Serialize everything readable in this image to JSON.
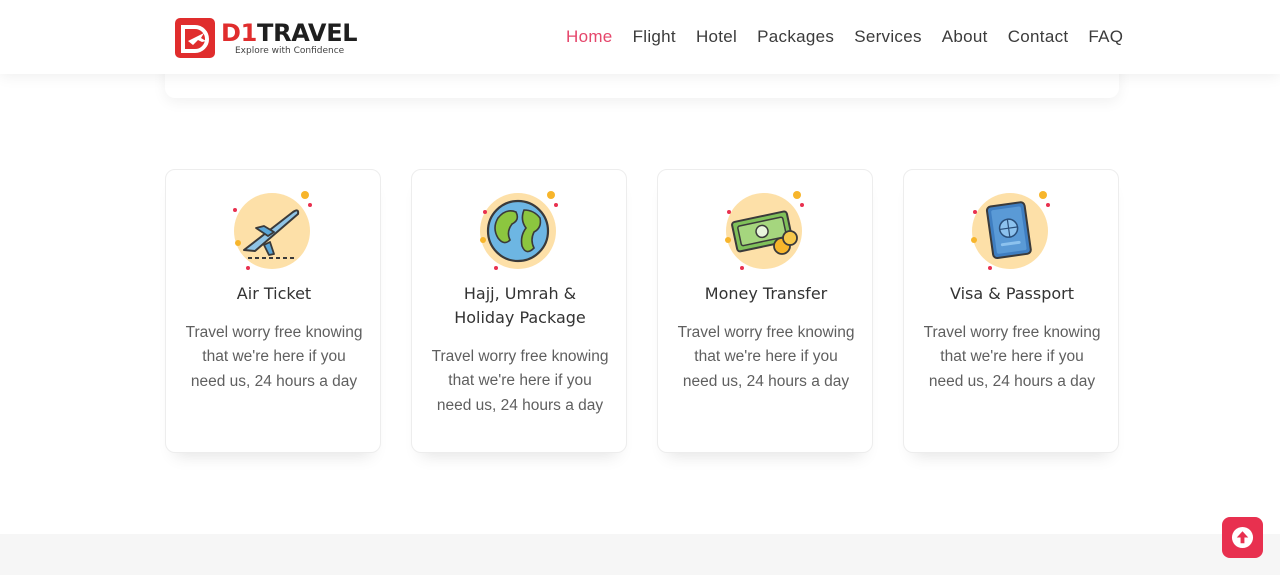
{
  "brand": {
    "name_part1": "D1",
    "name_part2": "TRAVEL",
    "tagline": "Explore with Confidence",
    "colors": {
      "primary": "#e02d2d",
      "accent": "#e5466b",
      "dark": "#1f1f1f"
    }
  },
  "nav": {
    "items": [
      {
        "label": "Home",
        "active": true
      },
      {
        "label": "Flight",
        "active": false
      },
      {
        "label": "Hotel",
        "active": false
      },
      {
        "label": "Packages",
        "active": false
      },
      {
        "label": "Services",
        "active": false
      },
      {
        "label": "About",
        "active": false
      },
      {
        "label": "Contact",
        "active": false
      },
      {
        "label": "FAQ",
        "active": false
      }
    ]
  },
  "services": [
    {
      "icon": "airplane-icon",
      "title_lines": [
        "Air Ticket"
      ],
      "desc_lines": [
        "Travel worry free knowing",
        "that we're here if you",
        "need us, 24 hours a day"
      ]
    },
    {
      "icon": "globe-icon",
      "title_lines": [
        "Hajj, Umrah &",
        "Holiday Package"
      ],
      "desc_lines": [
        "Travel worry free knowing",
        "that we're here if you",
        "need us, 24 hours a day"
      ]
    },
    {
      "icon": "money-icon",
      "title_lines": [
        "Money Transfer"
      ],
      "desc_lines": [
        "Travel worry free knowing",
        "that we're here if you",
        "need us, 24 hours a day"
      ]
    },
    {
      "icon": "passport-icon",
      "title_lines": [
        "Visa & Passport"
      ],
      "desc_lines": [
        "Travel worry free knowing",
        "that we're here if you",
        "need us, 24 hours a day"
      ]
    }
  ],
  "scroll_top": {
    "icon": "arrow-up-icon",
    "color": "#e8304f"
  }
}
